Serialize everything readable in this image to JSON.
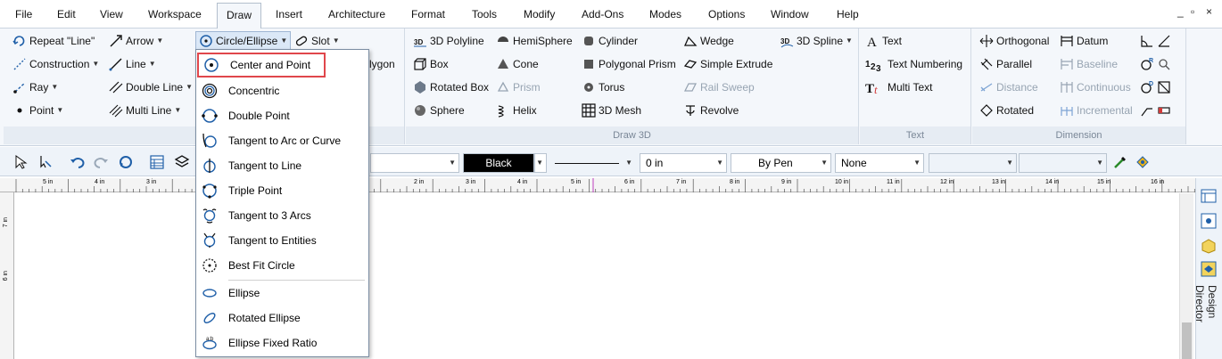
{
  "menu": [
    "File",
    "Edit",
    "View",
    "Workspace",
    "Draw",
    "Insert",
    "Architecture",
    "Format",
    "Tools",
    "Modify",
    "Add-Ons",
    "Modes",
    "Options",
    "Window",
    "Help"
  ],
  "window_controls": [
    "_",
    "▫",
    "×"
  ],
  "ribbon": {
    "draw2d": {
      "label": "Dr",
      "col1": [
        "Repeat \"Line\"",
        "Construction",
        "Ray",
        "Point"
      ],
      "col2": [
        "Arrow",
        "Line",
        "Double Line",
        "Multi Line"
      ],
      "col3": [
        "Circle/Ellipse",
        "Slot"
      ],
      "partial": "lygon"
    },
    "draw3d": {
      "label": "Draw 3D",
      "col1": [
        "3D Polyline",
        "Box",
        "Rotated Box",
        "Sphere"
      ],
      "col2": [
        "HemiSphere",
        "Cone",
        "Prism",
        "Helix"
      ],
      "col3": [
        "Cylinder",
        "Polygonal Prism",
        "Torus",
        "3D Mesh"
      ],
      "col4": [
        "Wedge",
        "Simple Extrude",
        "Rail Sweep",
        "Revolve"
      ],
      "col5": [
        "3D Spline"
      ]
    },
    "text": {
      "label": "Text",
      "items": [
        "Text",
        "Text Numbering",
        "Multi Text"
      ]
    },
    "dimension": {
      "label": "Dimension",
      "col1": [
        "Orthogonal",
        "Parallel",
        "Distance",
        "Rotated"
      ],
      "col2": [
        "Datum",
        "Baseline",
        "Continuous",
        "Incremental"
      ]
    }
  },
  "toolbar": {
    "color": "Black",
    "thickness": "0 in",
    "pen": "By Pen",
    "fill": "None"
  },
  "ruler": {
    "labels": [
      "5 in",
      "4 in",
      "3 in",
      "2 in",
      "3 in",
      "4 in",
      "5 in",
      "6 in",
      "7 in",
      "8 in",
      "9 in",
      "10 in",
      "11 in",
      "12 in",
      "13 in",
      "14 in",
      "15 in",
      "16 in"
    ],
    "vlabels": [
      "7 in",
      "6 in"
    ]
  },
  "side_panel": {
    "label": "Design Director"
  },
  "dropdown": {
    "items": [
      "Center and Point",
      "Concentric",
      "Double Point",
      "Tangent to Arc or Curve",
      "Tangent to Line",
      "Triple Point",
      "Tangent to 3 Arcs",
      "Tangent to Entities",
      "Best Fit Circle",
      "Ellipse",
      "Rotated Ellipse",
      "Ellipse Fixed Ratio"
    ]
  },
  "colors": {
    "accent": "#1f5fa8",
    "highlight": "#e0464b",
    "ribbon_bg": "#f4f7fb"
  }
}
